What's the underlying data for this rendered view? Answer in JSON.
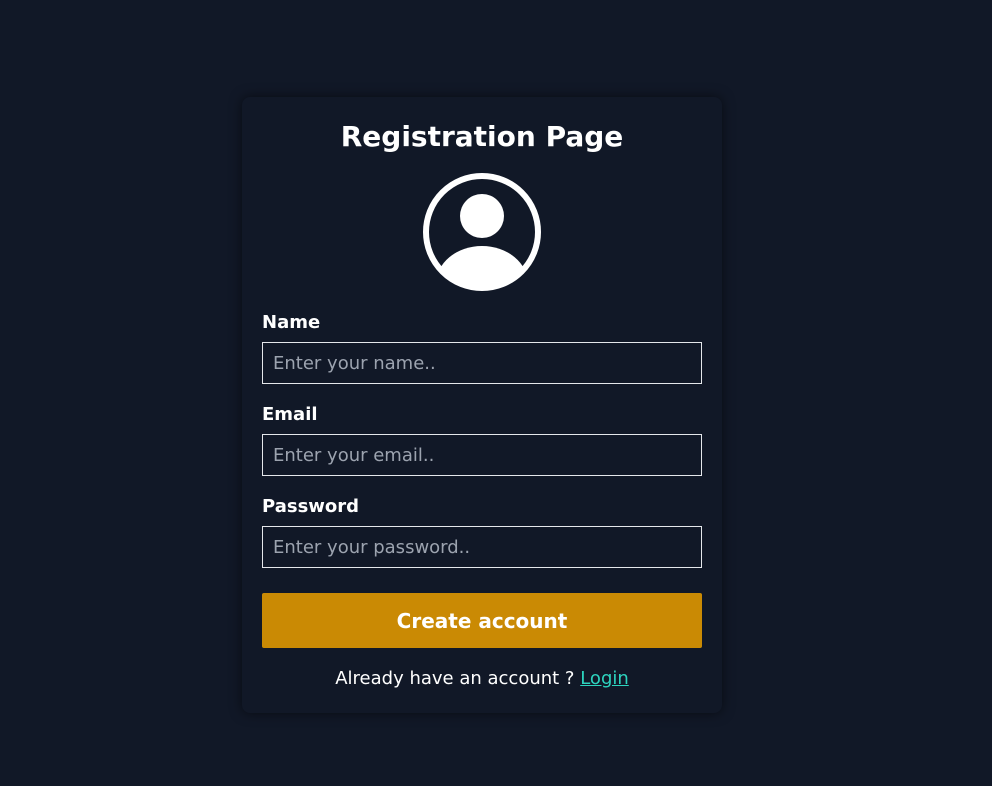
{
  "page": {
    "background_color": "#111827"
  },
  "form": {
    "title": "Registration Page",
    "avatar_icon": "user-circle-icon",
    "fields": [
      {
        "label": "Name",
        "placeholder": "Enter your name..",
        "value": ""
      },
      {
        "label": "Email",
        "placeholder": "Enter your email..",
        "value": ""
      },
      {
        "label": "Password",
        "placeholder": "Enter your password..",
        "value": ""
      }
    ],
    "submit_label": "Create account",
    "submit_color": "#ca8a04",
    "footer_text": "Already have an account ?",
    "login_label": "Login",
    "login_color": "#2dd4bf"
  }
}
